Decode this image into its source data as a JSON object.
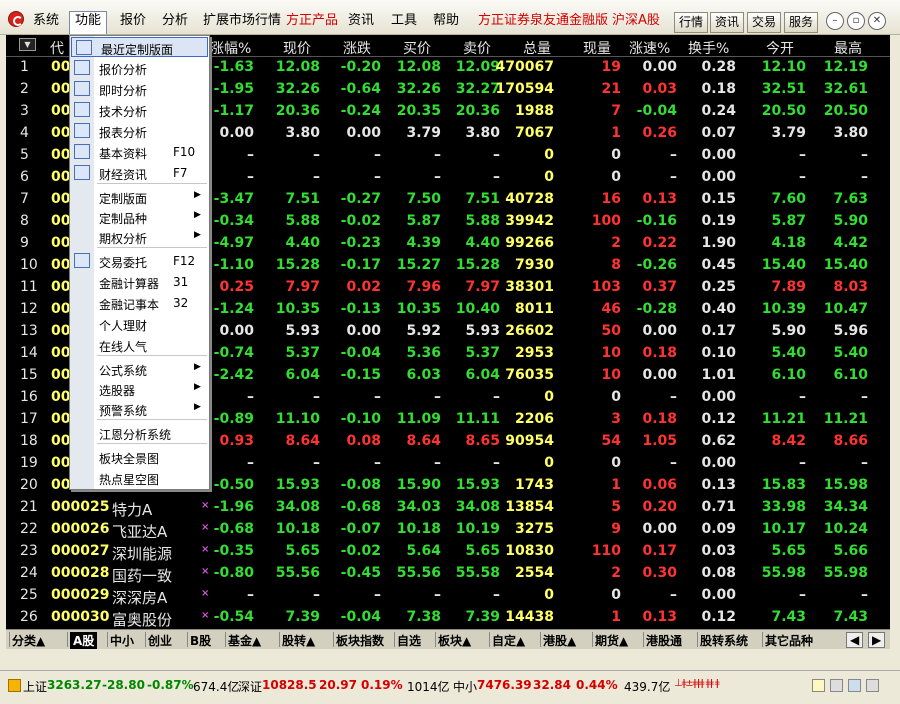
{
  "menu": {
    "items": [
      "系统",
      "功能",
      "报价",
      "分析",
      "扩展市场行情",
      "方正产品",
      "资讯",
      "工具",
      "帮助",
      "方正证券泉友通金融版",
      "沪深A股"
    ],
    "right_buttons": [
      "行情",
      "资讯",
      "交易",
      "服务"
    ]
  },
  "columns": [
    "代",
    "涨幅%",
    "现价",
    "涨跌",
    "买价",
    "卖价",
    "总量",
    "现量",
    "涨速%",
    "换手%",
    "今开",
    "最高"
  ],
  "rows": [
    [
      "1",
      "00",
      "",
      "-1.63",
      "12.08",
      "-0.20",
      "12.08",
      "12.09",
      "470067",
      "19",
      "0.00",
      "0.28",
      "12.10",
      "12.19"
    ],
    [
      "2",
      "00",
      "",
      "-1.95",
      "32.26",
      "-0.64",
      "32.26",
      "32.27",
      "170594",
      "21",
      "0.03",
      "0.18",
      "32.51",
      "32.61"
    ],
    [
      "3",
      "00",
      "",
      "-1.17",
      "20.36",
      "-0.24",
      "20.35",
      "20.36",
      "1988",
      "7",
      "-0.04",
      "0.24",
      "20.50",
      "20.50"
    ],
    [
      "4",
      "00",
      "",
      "0.00",
      "3.80",
      "0.00",
      "3.79",
      "3.80",
      "7067",
      "1",
      "0.26",
      "0.07",
      "3.79",
      "3.80"
    ],
    [
      "5",
      "00",
      "",
      "–",
      "–",
      "–",
      "–",
      "–",
      "0",
      "0",
      "–",
      "0.00",
      "–",
      "–"
    ],
    [
      "6",
      "00",
      "",
      "–",
      "–",
      "–",
      "–",
      "–",
      "0",
      "0",
      "–",
      "0.00",
      "–",
      "–"
    ],
    [
      "7",
      "00",
      "",
      "-3.47",
      "7.51",
      "-0.27",
      "7.50",
      "7.51",
      "40728",
      "16",
      "0.13",
      "0.15",
      "7.60",
      "7.63"
    ],
    [
      "8",
      "00",
      "",
      "-0.34",
      "5.88",
      "-0.02",
      "5.87",
      "5.88",
      "39942",
      "100",
      "-0.16",
      "0.19",
      "5.87",
      "5.90"
    ],
    [
      "9",
      "00",
      "",
      "-4.97",
      "4.40",
      "-0.23",
      "4.39",
      "4.40",
      "99266",
      "2",
      "0.22",
      "1.90",
      "4.18",
      "4.42"
    ],
    [
      "10",
      "00",
      "",
      "-1.10",
      "15.28",
      "-0.17",
      "15.27",
      "15.28",
      "7930",
      "8",
      "-0.26",
      "0.45",
      "15.40",
      "15.40"
    ],
    [
      "11",
      "00",
      "",
      "0.25",
      "7.97",
      "0.02",
      "7.96",
      "7.97",
      "38301",
      "103",
      "0.37",
      "0.25",
      "7.89",
      "8.03"
    ],
    [
      "12",
      "00",
      "",
      "-1.24",
      "10.35",
      "-0.13",
      "10.35",
      "10.40",
      "8011",
      "46",
      "-0.28",
      "0.40",
      "10.39",
      "10.47"
    ],
    [
      "13",
      "00",
      "",
      "0.00",
      "5.93",
      "0.00",
      "5.92",
      "5.93",
      "26602",
      "50",
      "0.00",
      "0.17",
      "5.90",
      "5.96"
    ],
    [
      "14",
      "00",
      "",
      "-0.74",
      "5.37",
      "-0.04",
      "5.36",
      "5.37",
      "2953",
      "10",
      "0.18",
      "0.10",
      "5.40",
      "5.40"
    ],
    [
      "15",
      "00",
      "",
      "-2.42",
      "6.04",
      "-0.15",
      "6.03",
      "6.04",
      "76035",
      "10",
      "0.00",
      "1.01",
      "6.10",
      "6.10"
    ],
    [
      "16",
      "00",
      "",
      "–",
      "–",
      "–",
      "–",
      "–",
      "0",
      "0",
      "–",
      "0.00",
      "–",
      "–"
    ],
    [
      "17",
      "00",
      "",
      "-0.89",
      "11.10",
      "-0.10",
      "11.09",
      "11.11",
      "2206",
      "3",
      "0.18",
      "0.12",
      "11.21",
      "11.21"
    ],
    [
      "18",
      "00",
      "",
      "0.93",
      "8.64",
      "0.08",
      "8.64",
      "8.65",
      "90954",
      "54",
      "1.05",
      "0.62",
      "8.42",
      "8.66"
    ],
    [
      "19",
      "00",
      "",
      "–",
      "–",
      "–",
      "–",
      "–",
      "0",
      "0",
      "–",
      "0.00",
      "–",
      "–"
    ],
    [
      "20",
      "00",
      "",
      "-0.50",
      "15.93",
      "-0.08",
      "15.90",
      "15.93",
      "1743",
      "1",
      "0.06",
      "0.13",
      "15.83",
      "15.98"
    ],
    [
      "21",
      "000025",
      "特力A",
      "-1.96",
      "34.08",
      "-0.68",
      "34.03",
      "34.08",
      "13854",
      "5",
      "0.20",
      "0.71",
      "33.98",
      "34.34"
    ],
    [
      "22",
      "000026",
      "飞亚达A",
      "-0.68",
      "10.18",
      "-0.07",
      "10.18",
      "10.19",
      "3275",
      "9",
      "0.00",
      "0.09",
      "10.17",
      "10.24"
    ],
    [
      "23",
      "000027",
      "深圳能源",
      "-0.35",
      "5.65",
      "-0.02",
      "5.64",
      "5.65",
      "10830",
      "110",
      "0.17",
      "0.03",
      "5.65",
      "5.66"
    ],
    [
      "24",
      "000028",
      "国药一致",
      "-0.80",
      "55.56",
      "-0.45",
      "55.56",
      "55.58",
      "2554",
      "2",
      "0.30",
      "0.08",
      "55.98",
      "55.98"
    ],
    [
      "25",
      "000029",
      "深深房A",
      "–",
      "–",
      "–",
      "–",
      "–",
      "0",
      "0",
      "–",
      "0.00",
      "–",
      "–"
    ],
    [
      "26",
      "000030",
      "富奥股份",
      "-0.54",
      "7.39",
      "-0.04",
      "7.38",
      "7.39",
      "14438",
      "1",
      "0.13",
      "0.12",
      "7.43",
      "7.43"
    ]
  ],
  "popup": [
    {
      "label": "最近定制版面",
      "key": "",
      "icon": "layout-icon",
      "sub": false
    },
    {
      "label": "报价分析",
      "key": "",
      "icon": "quote-icon",
      "sub": false
    },
    {
      "label": "即时分析",
      "key": "",
      "icon": "line-chart-icon",
      "sub": false
    },
    {
      "label": "技术分析",
      "key": "",
      "icon": "candle-icon",
      "sub": false
    },
    {
      "label": "报表分析",
      "key": "",
      "icon": "report-icon",
      "sub": false
    },
    {
      "label": "基本资料",
      "key": "F10",
      "icon": "f10-icon",
      "sub": false
    },
    {
      "label": "财经资讯",
      "key": "F7",
      "icon": "news-icon",
      "sub": false
    },
    {
      "label": "定制版面",
      "key": "",
      "icon": "",
      "sub": true
    },
    {
      "label": "定制品种",
      "key": "",
      "icon": "",
      "sub": true
    },
    {
      "label": "期权分析",
      "key": "",
      "icon": "",
      "sub": true
    },
    {
      "label": "交易委托",
      "key": "F12",
      "icon": "f12-icon",
      "sub": false
    },
    {
      "label": "金融计算器",
      "key": "31",
      "icon": "",
      "sub": false
    },
    {
      "label": "金融记事本",
      "key": "32",
      "icon": "",
      "sub": false
    },
    {
      "label": "个人理财",
      "key": "",
      "icon": "",
      "sub": false
    },
    {
      "label": "在线人气",
      "key": "",
      "icon": "",
      "sub": false
    },
    {
      "label": "公式系统",
      "key": "",
      "icon": "",
      "sub": true
    },
    {
      "label": "选股器",
      "key": "",
      "icon": "",
      "sub": true
    },
    {
      "label": "预警系统",
      "key": "",
      "icon": "",
      "sub": true
    },
    {
      "label": "江恩分析系统",
      "key": "",
      "icon": "",
      "sub": false
    },
    {
      "label": "板块全景图",
      "key": "",
      "icon": "",
      "sub": false
    },
    {
      "label": "热点星空图",
      "key": "",
      "icon": "",
      "sub": false
    }
  ],
  "tabs": [
    "分类▲",
    "A股",
    "中小",
    "创业",
    "B股",
    "基金▲",
    "股转▲",
    "板块指数",
    "自选",
    "板块▲",
    "自定▲",
    "港股▲",
    "期货▲",
    "港股通",
    "股转系统",
    "其它品种"
  ],
  "status": {
    "sh_label": "上证",
    "sh_val": "3263.27",
    "sh_chg": "-28.80",
    "sh_pct": "-0.87%",
    "sh_amt": "674.4亿",
    "sz_label": "深证",
    "sz_val": "10828.5",
    "sz_chg": "20.97",
    "sz_pct": "0.19%",
    "sz_amt": "1014亿",
    "zx_label": "中小",
    "zx_val": "7476.39",
    "zx_chg": "32.84",
    "zx_pct": "0.44%",
    "zx_amt": "439.7亿"
  }
}
